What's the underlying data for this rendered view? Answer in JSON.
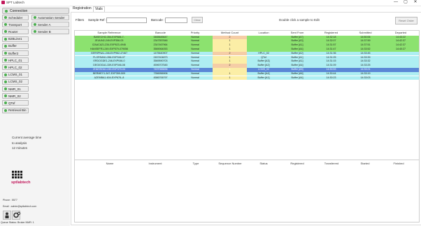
{
  "window": {
    "title": "SPT Labtech",
    "min": "—",
    "max": "▢",
    "close": "✕"
  },
  "sidebar": {
    "connection_label": "Connection",
    "left_items": [
      "Scheduler",
      "Transport",
      "Router",
      "B2BLine1",
      "Buffer",
      "Buffer2",
      "HPLC_01",
      "HPLC_02",
      "LCMS_01",
      "LCMS_02",
      "NMR_01",
      "NMR_02",
      "QTof",
      "Retrieval Bin"
    ],
    "right_items": [
      "Automation Sender",
      "Sender A",
      "Sender B"
    ],
    "avg_text": [
      "Current average time",
      "to analysis",
      "12 minutes"
    ],
    "logo_text": "sptlabtech",
    "phone": "Phone : 5577",
    "email": "Email : admin@sptlabtech.com",
    "status_color": "#4caf50"
  },
  "tabs": [
    "Registration",
    "Vials"
  ],
  "filters": {
    "title": "Filters",
    "sample_ref_label": "Sample Ref :",
    "sample_ref_value": "",
    "barcode_label": "Barcode :",
    "barcode_value": "",
    "clear_label": "Clear",
    "hint": "Double click a sample to Edit",
    "reset_label": "Reset Order"
  },
  "vials_table": {
    "columns": [
      "Sample Reference",
      "Barcode",
      "Priority",
      "Method Count",
      "Location",
      "Sent From",
      "Registered",
      "Submitted",
      "Departed"
    ],
    "rows": [
      [
        "BASECHI2-354-EXP684-7-",
        "3465645647",
        "Normal",
        "2",
        "",
        "Buffer [A7]",
        "14:32:18",
        "14:50:06",
        "14:43:22"
      ],
      [
        "JEUUN2-249-EXP356-03",
        "2347557846",
        "Normal",
        "1",
        "",
        "Buffer [A3]",
        "14:32:07",
        "14:37:59",
        "14:42:37"
      ],
      [
        "IZAACA21-234-EXP623-4946",
        "2347467964",
        "Normal",
        "1",
        "",
        "Buffer [A1]",
        "14:31:57",
        "14:37:51",
        "14:42:37"
      ],
      [
        "HANSEFR1-249-EXP579-079056",
        "3569064053",
        "Normal",
        "1",
        "",
        "Buffer [A4]",
        "14:31:47",
        "14:33:52",
        "14:40:27"
      ],
      [
        "GERSPNA1-248-EXP962-47467",
        "1475640907",
        "Normal",
        "2",
        "HPLC_02",
        "Buffer [A2]",
        "14:31:36",
        "14:33:45",
        ""
      ],
      [
        "FLORSAN1-356-EXP046-07",
        "2457404873",
        "Normal",
        "1",
        "QTof",
        "Buffer [A1]",
        "14:31:25",
        "14:33:39",
        ""
      ],
      [
        "ERDOGDE1-246-EXP046-0",
        "3569590703",
        "Normal",
        "1",
        "Buffer [A3]",
        "Buffer [A1]",
        "14:31:15",
        "14:33:32",
        ""
      ],
      [
        "DEGIOGA1-339-EXP046-08",
        "4596707545",
        "Normal",
        "2",
        "Buffer [A2]",
        "Buffer [A4]",
        "14:31:09",
        "14:33:25",
        ""
      ],
      [
        "ZHASSOA1-249-EXP470-04",
        "7497065836",
        "Normal",
        "1",
        "LCMS_02",
        "Buffer [A5]",
        "14:30:53",
        "14:33:21",
        ""
      ],
      [
        "BERMEY1-347-EXP359-509",
        "7356956906",
        "Normal",
        "1",
        "Buffer [A4]",
        "Buffer [A6]",
        "14:30:44",
        "14:33:19",
        ""
      ],
      [
        "AZEMBA1-604-EXP678--8",
        "4586706797",
        "Normal",
        "1",
        "Buffer [A1]",
        "Buffer [A4]",
        "14:30:23",
        "14:33:03",
        ""
      ]
    ],
    "row_colors": [
      "#8ce26f",
      "#8ce26f",
      "#8ce26f",
      "#8ce26f",
      "#aeeef2",
      "#aeeef2",
      "#aeeef2",
      "#aeeef2",
      "#5b87d6",
      "#aeeef2",
      "#aeeef2"
    ],
    "method_colors": [
      "#f5cda6",
      "#fbeea6",
      "#fbeea6",
      "#fbeea6",
      "#f5cda6",
      "#fbeea6",
      "#fbeea6",
      "#f5cda6",
      "#fbeea6",
      "#fbeea6",
      "#fbeea6"
    ]
  },
  "queue_table": {
    "columns": [
      "Name",
      "Instrument",
      "Type",
      "Sequence Number",
      "Status",
      "Registered",
      "Transferred",
      "Started",
      "Finished"
    ]
  },
  "status_bar": "Queue Status: Bruker NMR: 1"
}
